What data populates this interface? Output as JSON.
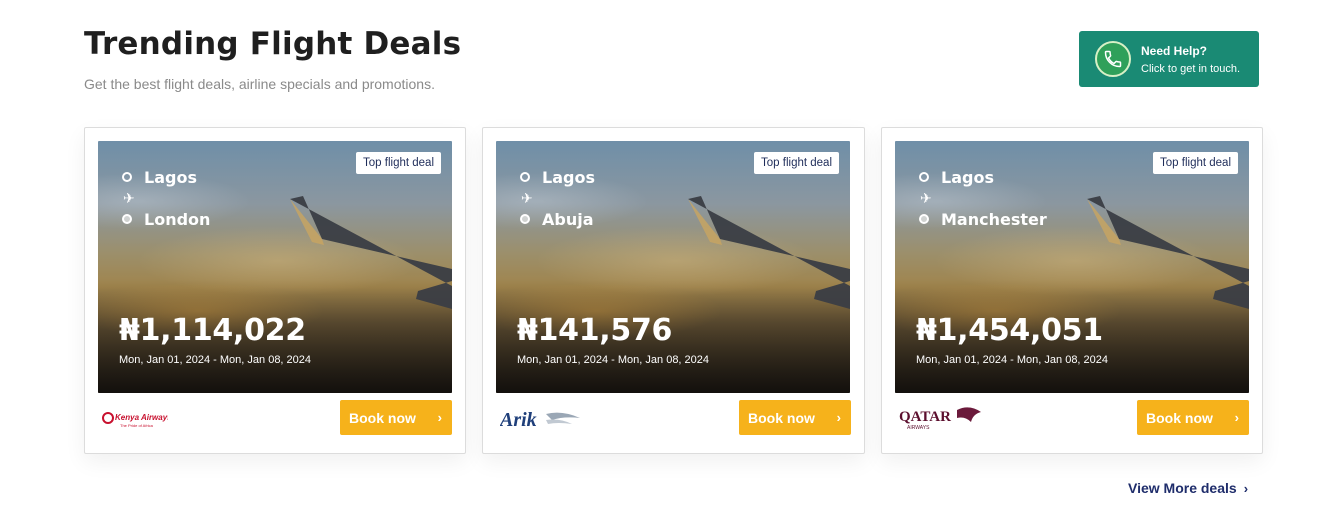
{
  "header": {
    "title": "Trending Flight Deals",
    "subtitle": "Get the best flight deals, airline specials and promotions."
  },
  "help": {
    "title": "Need Help?",
    "subtitle": "Click to get in touch."
  },
  "deals": [
    {
      "badge": "Top flight deal",
      "origin": "Lagos",
      "destination": "London",
      "price": "₦1,114,022",
      "dates": "Mon, Jan 01, 2024 - Mon, Jan 08, 2024",
      "airline_logo": "Kenya Airways",
      "logo_tagline": "The Pride of Africa",
      "book_label": "Book now"
    },
    {
      "badge": "Top flight deal",
      "origin": "Lagos",
      "destination": "Abuja",
      "price": "₦141,576",
      "dates": "Mon, Jan 01, 2024 - Mon, Jan 08, 2024",
      "airline_logo": "Arik",
      "book_label": "Book now"
    },
    {
      "badge": "Top flight deal",
      "origin": "Lagos",
      "destination": "Manchester",
      "price": "₦1,454,051",
      "dates": "Mon, Jan 01, 2024 - Mon, Jan 08, 2024",
      "airline_logo": "QATAR",
      "logo_tagline": "AIRWAYS",
      "book_label": "Book now"
    }
  ],
  "view_more": "View More deals",
  "colors": {
    "help_bg": "#1a8a74",
    "book_bg": "#f6b21b",
    "link": "#1f2d6b"
  }
}
